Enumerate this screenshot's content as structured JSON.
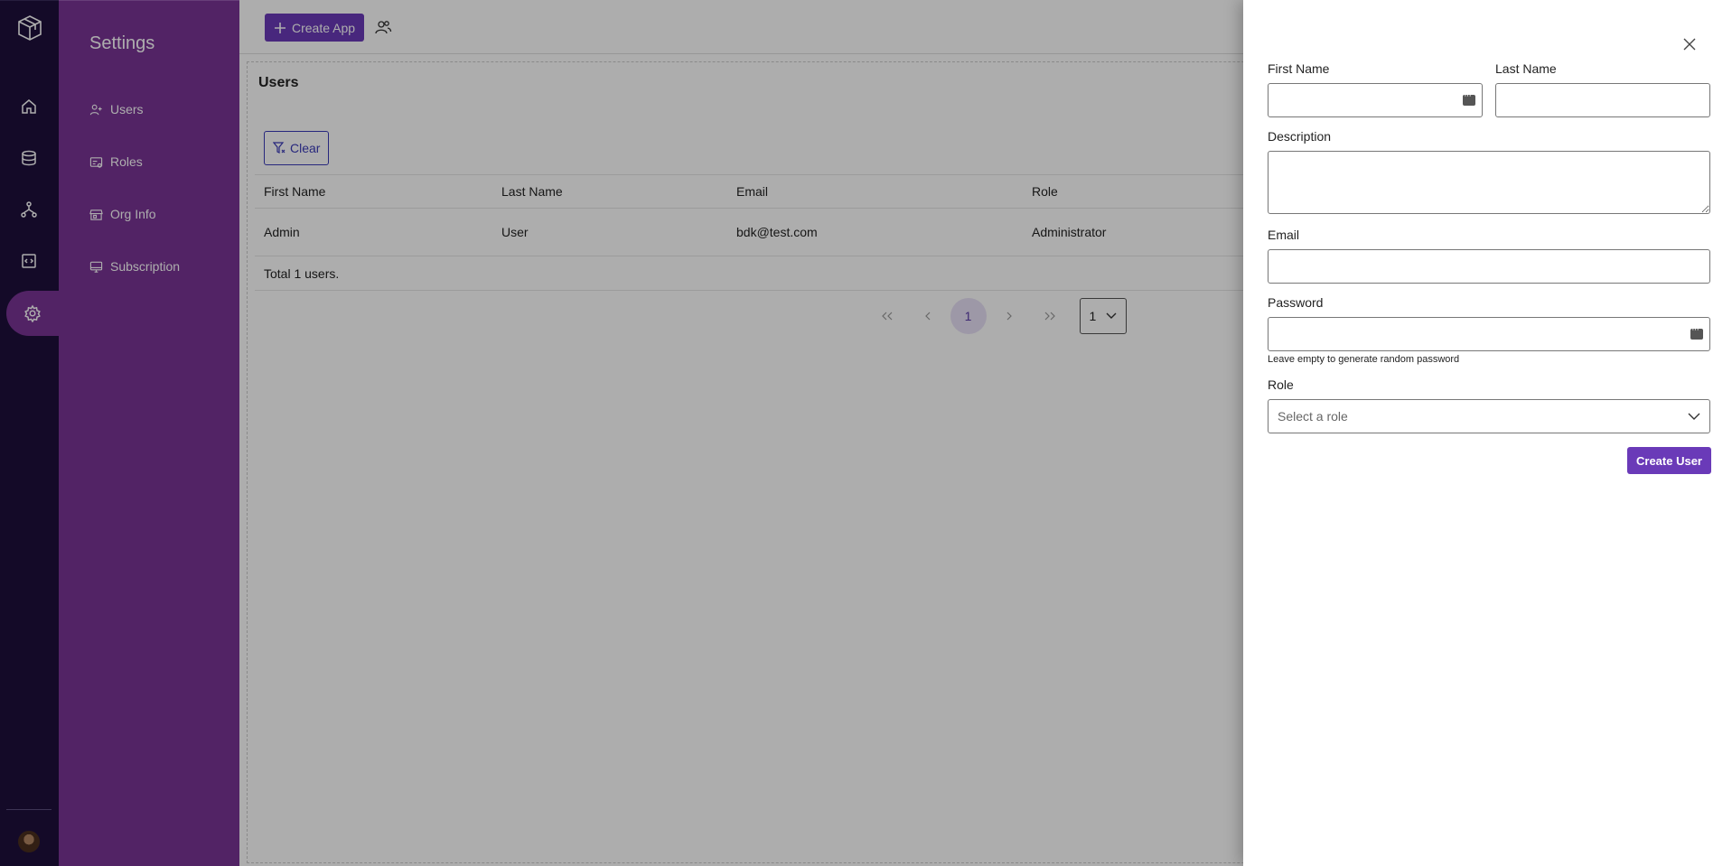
{
  "colors": {
    "rail_bg": "#1e0f3c",
    "sidebar_bg": "#7a3496",
    "primary": "#6a3ab8"
  },
  "rail": {
    "icons": [
      "logo-icon",
      "home-icon",
      "database-icon",
      "workflow-icon",
      "code-icon",
      "settings-icon"
    ],
    "active": "settings-icon"
  },
  "sidebar": {
    "title": "Settings",
    "items": [
      {
        "label": "Users",
        "icon": "user-add-icon"
      },
      {
        "label": "Roles",
        "icon": "roles-icon"
      },
      {
        "label": "Org Info",
        "icon": "store-icon"
      },
      {
        "label": "Subscription",
        "icon": "monitor-icon"
      }
    ]
  },
  "topbar": {
    "create_app_label": "Create App"
  },
  "main": {
    "title": "Users",
    "clear_label": "Clear",
    "table": {
      "headers": [
        "First Name",
        "Last Name",
        "Email",
        "Role"
      ],
      "rows": [
        [
          "Admin",
          "User",
          "bdk@test.com",
          "Administrator"
        ]
      ]
    },
    "total_text": "Total 1 users.",
    "pagination": {
      "current_page": "1",
      "rows_per_page": "1"
    }
  },
  "drawer": {
    "first_name_label": "First Name",
    "last_name_label": "Last Name",
    "description_label": "Description",
    "email_label": "Email",
    "password_label": "Password",
    "password_hint": "Leave empty to generate random password",
    "role_label": "Role",
    "role_placeholder": "Select a role",
    "submit_label": "Create User",
    "first_name_value": "",
    "last_name_value": "",
    "description_value": "",
    "email_value": "",
    "password_value": ""
  }
}
